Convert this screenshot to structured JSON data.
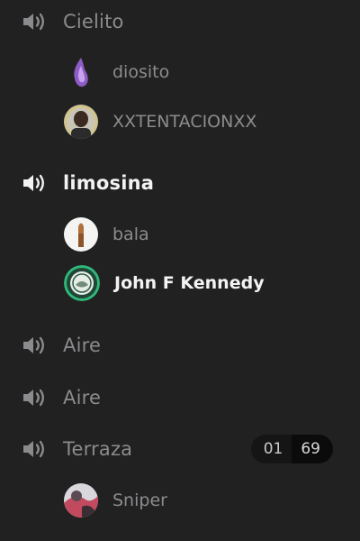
{
  "channels": [
    {
      "name": "Cielito",
      "icon": "speaker-icon",
      "users": [
        {
          "name": "diosito",
          "avatar": "purple-flame-avatar"
        },
        {
          "name": "XXTENTACIONXX",
          "avatar": "portrait-avatar"
        }
      ]
    },
    {
      "name": "limosina",
      "icon": "speaker-icon",
      "users": [
        {
          "name": "bala",
          "avatar": "bullet-avatar"
        },
        {
          "name": "John F Kennedy",
          "avatar": "seal-avatar"
        }
      ]
    },
    {
      "name": "Aire",
      "icon": "speaker-icon",
      "users": []
    },
    {
      "name": "Aire",
      "icon": "speaker-icon",
      "users": []
    },
    {
      "name": "Terraza",
      "icon": "speaker-icon",
      "user_count": "01",
      "user_limit": "69",
      "users": [
        {
          "name": "Sniper",
          "avatar": "photo-avatar"
        }
      ]
    }
  ],
  "colors": {
    "background": "#212121",
    "muted_text": "#8b8b8e",
    "active_text": "#f2f2f2",
    "speaking_ring": "#2fb87a"
  }
}
